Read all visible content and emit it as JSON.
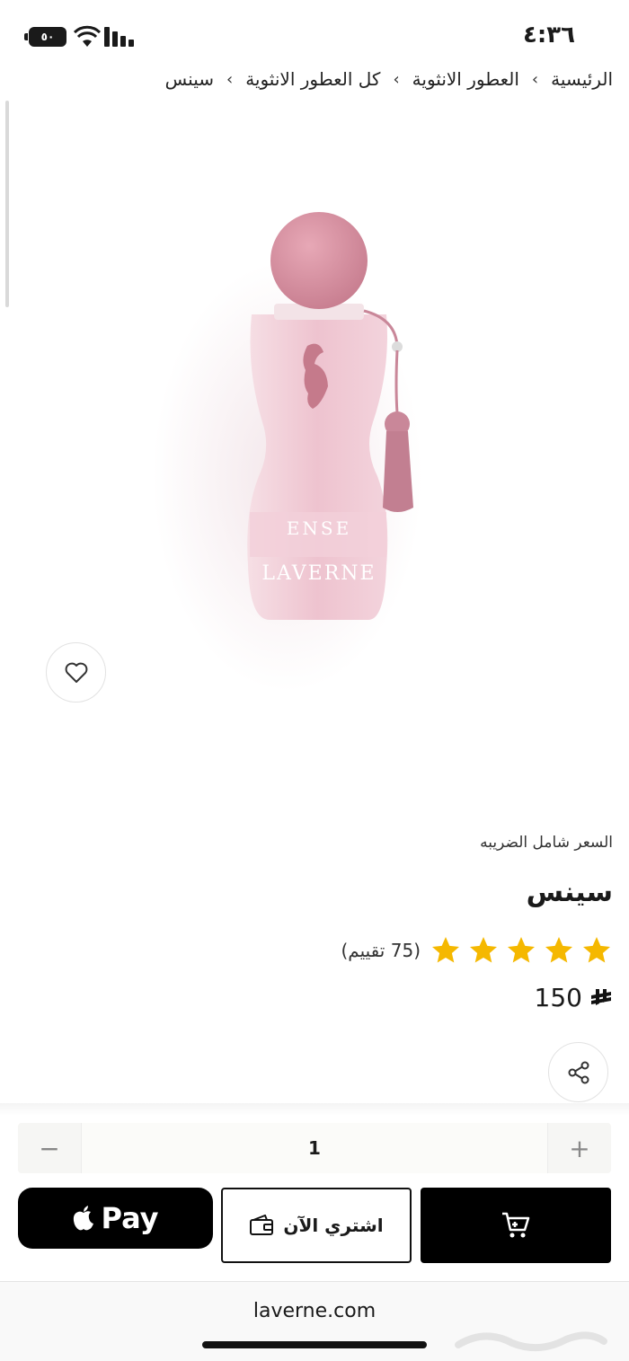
{
  "status": {
    "time": "٤:٣٦",
    "battery": "٥٠"
  },
  "breadcrumb": {
    "items": [
      "الرئيسية",
      "العطور الانثوية",
      "كل العطور الانثوية",
      "سينس"
    ],
    "separator": "›"
  },
  "product": {
    "image_label": "ENSE",
    "image_brand": "LAVERNE",
    "tax_note": "السعر شامل الضريبه",
    "title": "سينس",
    "stars": 5,
    "rating_text": "(75 تقييم)",
    "price": "150",
    "currency_icon": "riyal-icon"
  },
  "quantity": {
    "value": "1",
    "minus": "−",
    "plus": "+"
  },
  "actions": {
    "apple_pay_label": "Pay",
    "buy_now_label": "اشتري الآن"
  },
  "browser": {
    "url": "laverne.com"
  },
  "colors": {
    "star": "#f5b800",
    "bottle_pink": "#e9b8c4",
    "cap_pink": "#d98d9e",
    "button_black": "#000000"
  }
}
